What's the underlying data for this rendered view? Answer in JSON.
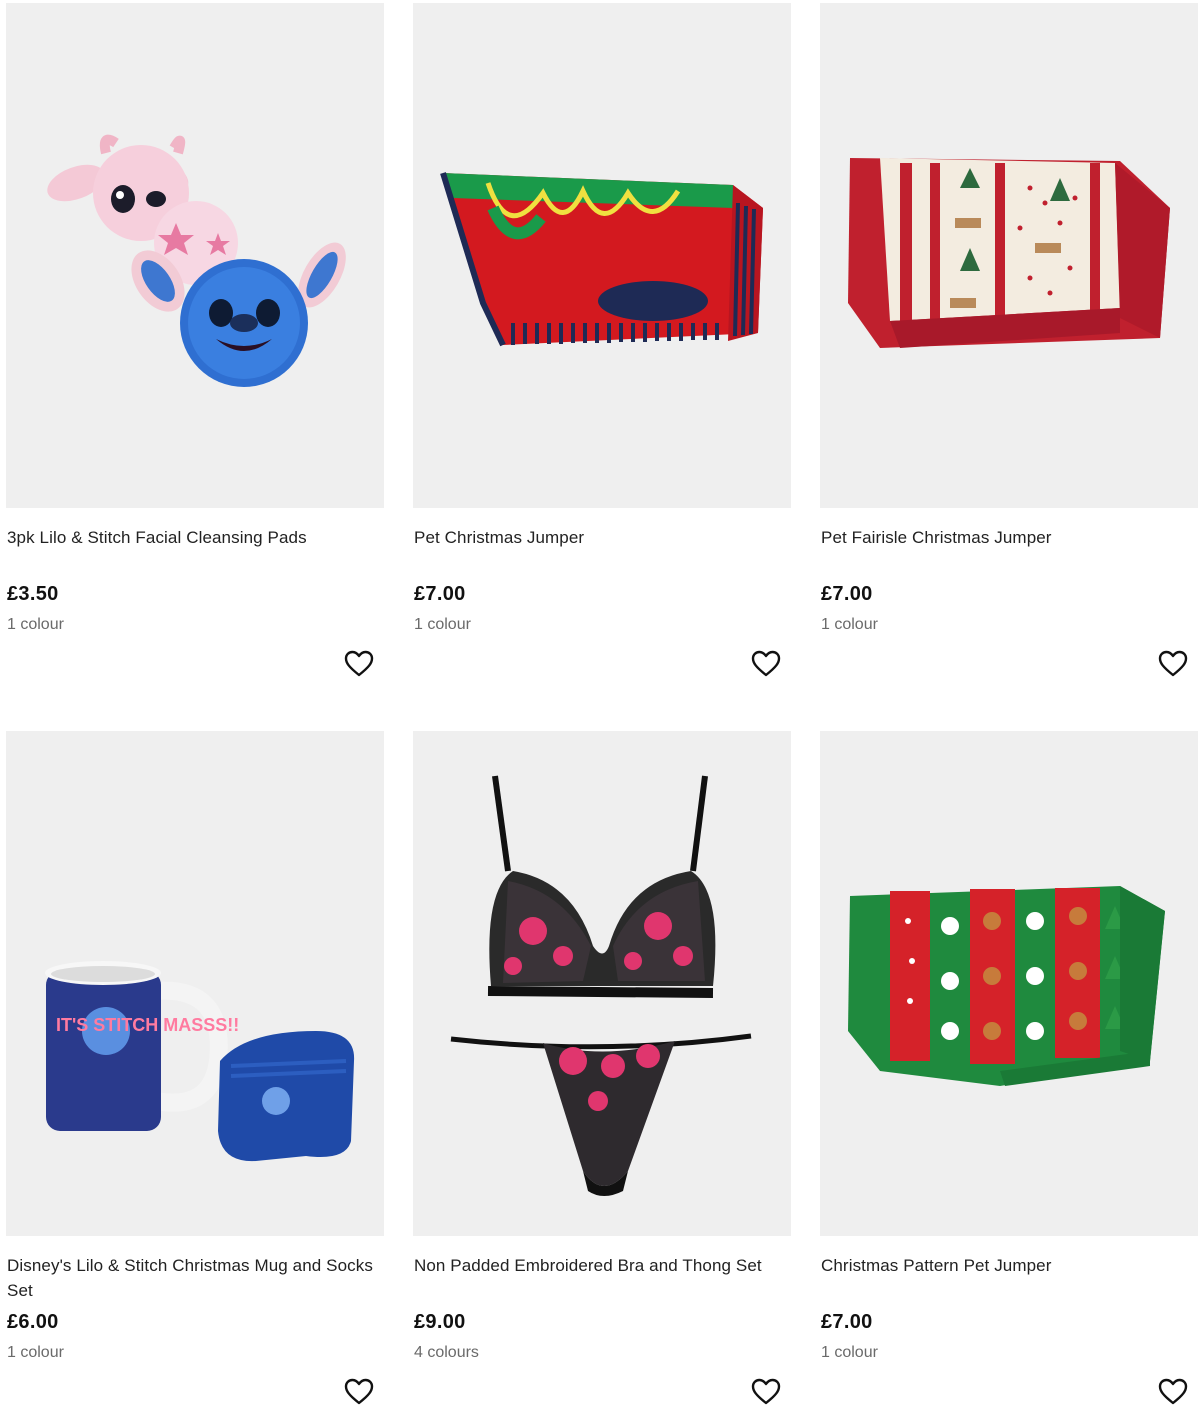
{
  "products": [
    {
      "title": "3pk Lilo & Stitch Facial Cleansing Pads",
      "price": "£3.50",
      "colours": "1 colour",
      "image_icon": "stitch-cleansing-pads-image",
      "wishlist_icon": "heart-icon"
    },
    {
      "title": "Pet Christmas Jumper",
      "price": "£7.00",
      "colours": "1 colour",
      "image_icon": "red-pet-jumper-image",
      "wishlist_icon": "heart-icon"
    },
    {
      "title": "Pet Fairisle Christmas Jumper",
      "price": "£7.00",
      "colours": "1 colour",
      "image_icon": "fairisle-pet-jumper-image",
      "wishlist_icon": "heart-icon"
    },
    {
      "title": "Disney's Lilo & Stitch Christmas Mug and Socks Set",
      "price": "£6.00",
      "colours": "1 colour",
      "image_icon": "stitch-mug-socks-image",
      "wishlist_icon": "heart-icon"
    },
    {
      "title": "Non Padded Embroidered Bra and Thong Set",
      "price": "£9.00",
      "colours": "4 colours",
      "image_icon": "bra-thong-set-image",
      "wishlist_icon": "heart-icon"
    },
    {
      "title": "Christmas Pattern Pet Jumper",
      "price": "£7.00",
      "colours": "1 colour",
      "image_icon": "green-pet-jumper-image",
      "wishlist_icon": "heart-icon"
    }
  ],
  "mug_text": "IT'S STITCH MASSS!!",
  "colors": {
    "image_background": "#efefef",
    "price_text": "#111111",
    "colour_count_text": "#6a6a6a"
  }
}
